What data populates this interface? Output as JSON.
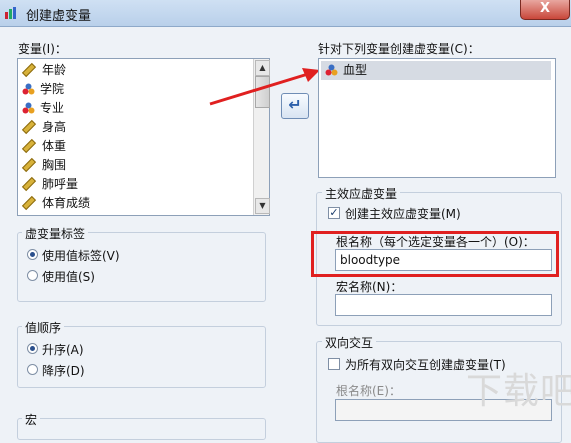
{
  "window": {
    "title": "创建虚变量",
    "close_glyph": "X"
  },
  "variables_label": "变量(I)：",
  "variables": [
    {
      "name": "年龄",
      "icon": "scale-ruler-icon"
    },
    {
      "name": "学院",
      "icon": "nominal-icon"
    },
    {
      "name": "专业",
      "icon": "nominal-icon"
    },
    {
      "name": "身高",
      "icon": "scale-ruler-icon"
    },
    {
      "name": "体重",
      "icon": "scale-ruler-icon"
    },
    {
      "name": "胸围",
      "icon": "scale-ruler-icon"
    },
    {
      "name": "肺呼量",
      "icon": "scale-ruler-icon"
    },
    {
      "name": "体育成绩",
      "icon": "scale-ruler-icon"
    }
  ],
  "move_button_glyph": "↵",
  "target_label": "针对下列变量创建虚变量(C)：",
  "target_items": [
    {
      "name": "血型",
      "icon": "nominal-icon",
      "selected": true
    }
  ],
  "dummy_label_group": {
    "title": "虚变量标签",
    "options": [
      {
        "label": "使用值标签(V)",
        "checked": true
      },
      {
        "label": "使用值(S)",
        "checked": false
      }
    ]
  },
  "value_order_group": {
    "title": "值顺序",
    "options": [
      {
        "label": "升序(A)",
        "checked": true
      },
      {
        "label": "降序(D)",
        "checked": false
      }
    ]
  },
  "macro_group": {
    "title": "宏"
  },
  "main_effect_group": {
    "title": "主效应虚变量",
    "create_checkbox": {
      "label": "创建主效应虚变量(M)",
      "checked": true
    },
    "root_name_label": "根名称（每个选定变量各一个）(O)：",
    "root_name_value": "bloodtype",
    "macro_name_label": "宏名称(N)：",
    "macro_name_value": ""
  },
  "twoway_group": {
    "title": "双向交互",
    "create_checkbox": {
      "label": "为所有双向交互创建虚变量(T)",
      "checked": false
    },
    "root_name_label": "根名称(E)：",
    "root_name_value": ""
  },
  "watermark": "下载吧",
  "accent_colors": {
    "highlight_red": "#e02020",
    "arrow_red": "#e02020",
    "selection": "#d6dbe3"
  }
}
